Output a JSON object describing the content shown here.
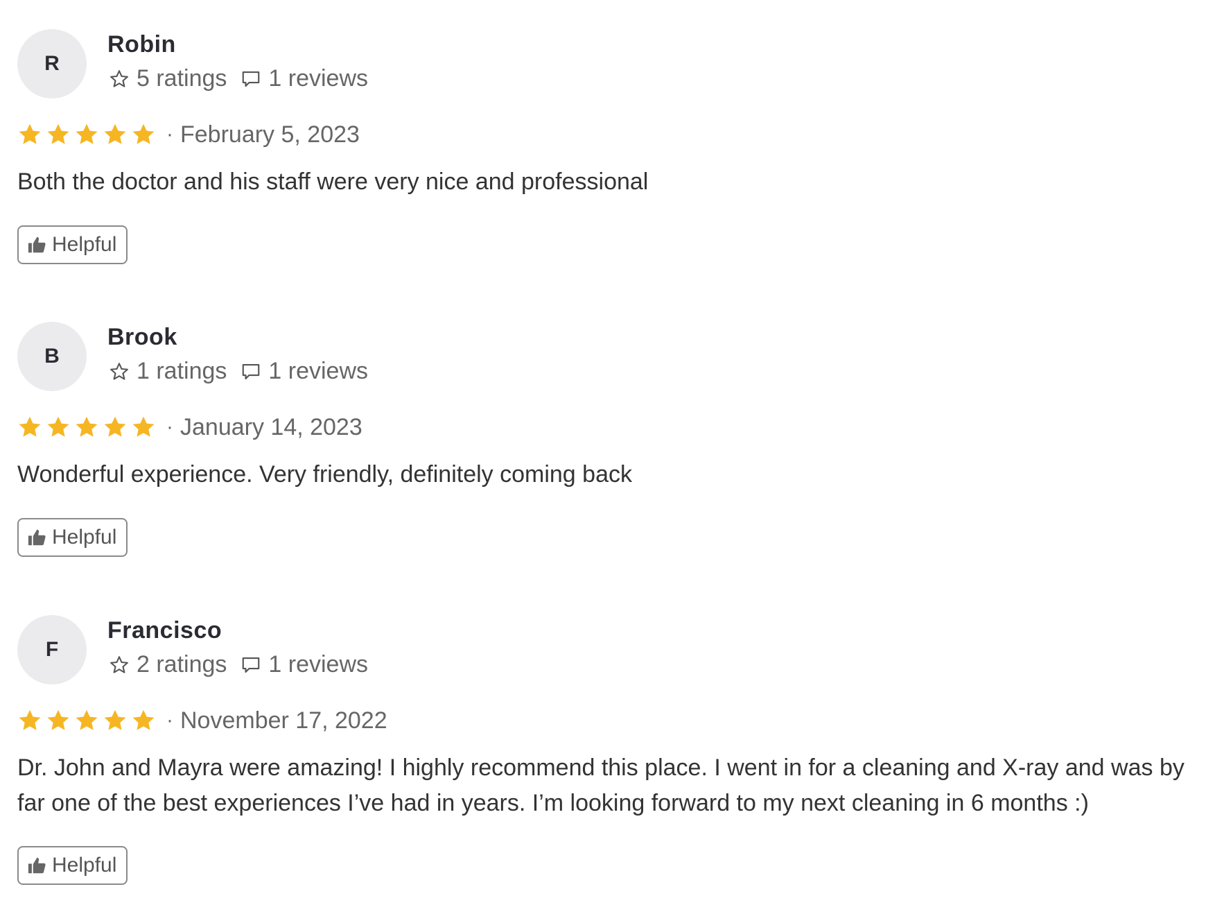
{
  "colors": {
    "star": "#f6b623",
    "avatar_bg": "#ebebed",
    "name": "#2b2b33",
    "meta": "#666666",
    "body": "#333333",
    "button_border": "#8a8a8a"
  },
  "icons": {
    "ratings": "star-outline-icon",
    "reviews": "speech-bubble-icon",
    "stars": "star-filled-icon",
    "helpful": "thumbs-up-icon"
  },
  "reviews": [
    {
      "initial": "R",
      "name": "Robin",
      "ratings": "5 ratings",
      "reviews": "1 reviews",
      "stars": 5,
      "separator": "·",
      "date": "February 5, 2023",
      "text": "Both the doctor and his staff were very nice and professional",
      "helpful_label": "Helpful"
    },
    {
      "initial": "B",
      "name": "Brook",
      "ratings": "1 ratings",
      "reviews": "1 reviews",
      "stars": 5,
      "separator": "·",
      "date": "January 14, 2023",
      "text": "Wonderful experience. Very friendly, definitely coming back",
      "helpful_label": "Helpful"
    },
    {
      "initial": "F",
      "name": "Francisco",
      "ratings": "2 ratings",
      "reviews": "1 reviews",
      "stars": 5,
      "separator": "·",
      "date": "November 17, 2022",
      "text": "Dr. John and Mayra were amazing! I highly recommend this place. I went in for a cleaning and X-ray and was by far one of the best experiences I’ve had in years. I’m looking forward to my next cleaning in 6 months :)",
      "helpful_label": "Helpful"
    }
  ]
}
